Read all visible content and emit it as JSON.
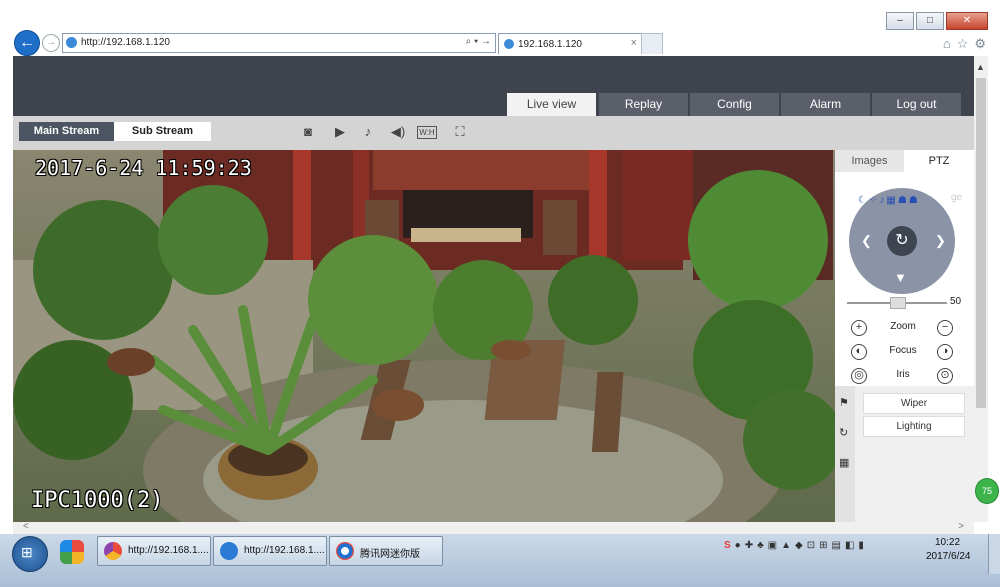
{
  "browser": {
    "address": "http://192.168.1.120",
    "tab_title": "192.168.1.120",
    "title_buttons": [
      "–",
      "□",
      "✕"
    ],
    "back_glyph": "←",
    "forward_glyph": "→",
    "address_controls": "⌕ ▾ →",
    "tab_close": "×",
    "toolbar_icons": [
      "⌂",
      "☆",
      "⚙"
    ]
  },
  "nav": {
    "tabs": [
      {
        "label": "Live view",
        "active": true
      },
      {
        "label": "Replay",
        "active": false
      },
      {
        "label": "Config",
        "active": false
      },
      {
        "label": "Alarm",
        "active": false
      },
      {
        "label": "Log out",
        "active": false
      }
    ]
  },
  "stream": {
    "main_label": "Main Stream",
    "sub_label": "Sub Stream",
    "tools": [
      {
        "icon": "camera-snapshot-icon",
        "glyph": "◙"
      },
      {
        "icon": "video-record-icon",
        "glyph": "▶"
      },
      {
        "icon": "microphone-icon",
        "glyph": "♪"
      },
      {
        "icon": "speaker-icon",
        "glyph": "◀)"
      },
      {
        "icon": "wh-aspect-icon",
        "glyph": "W:H"
      },
      {
        "icon": "fullscreen-icon",
        "glyph": "⛶"
      }
    ]
  },
  "video": {
    "timestamp": "2017-6-24 11:59:23",
    "camera_name": "IPC1000(2)"
  },
  "panel": {
    "tab_images": "Images",
    "tab_ptz": "PTZ",
    "ptz_icons": [
      "☾",
      "⁘",
      "♪",
      "▦",
      "☗",
      "☗"
    ],
    "ghost_text": "ge",
    "center_glyph": "↻",
    "arrow_left": "❮",
    "arrow_right": "❯",
    "arrow_down": "▼",
    "speed_value": "50",
    "speed_level": 0.5,
    "rows": [
      {
        "label": "Zoom",
        "left": "+",
        "right": "−"
      },
      {
        "label": "Focus",
        "left": "◐",
        "right": "◑"
      },
      {
        "label": "Iris",
        "left": "◎",
        "right": "⊙"
      }
    ],
    "side_icons": [
      {
        "name": "flag-icon",
        "glyph": "⚑"
      },
      {
        "name": "cruise-icon",
        "glyph": "↻"
      },
      {
        "name": "grid-icon",
        "glyph": "▦"
      }
    ],
    "wiper": "Wiper",
    "lighting": "Lighting"
  },
  "scroll": {
    "up": "▲",
    "left": "<",
    "right": ">"
  },
  "badge": "75",
  "taskbar": {
    "start_glyph": "⊞",
    "tasks": [
      {
        "label": "http://192.168.1....",
        "color": "#d43fb5"
      },
      {
        "label": "http://192.168.1....",
        "color": "#2b7bd6"
      },
      {
        "label": "腾讯网迷你版",
        "color": "#1f6fd0"
      }
    ],
    "tray": [
      "S",
      "●",
      "✚",
      "♣",
      "▣",
      "▲",
      "◆",
      "⊡",
      "⊞",
      "▤",
      "◧",
      "▮"
    ],
    "time": "10:22",
    "date": "2017/6/24"
  }
}
